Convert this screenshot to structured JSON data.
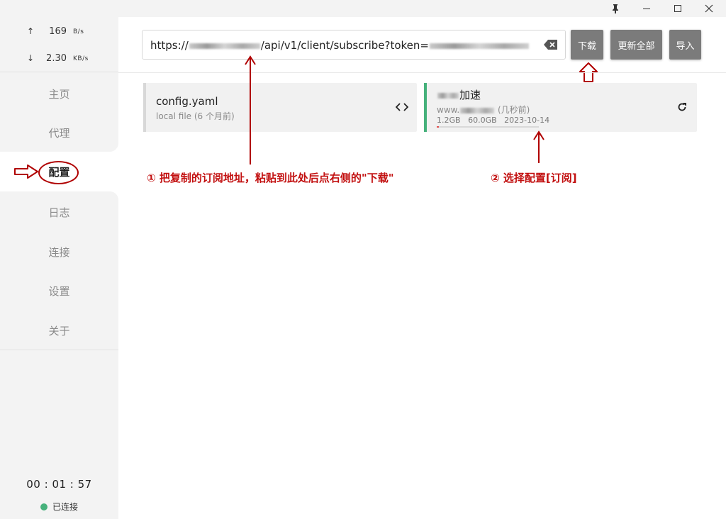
{
  "window": {
    "pin_icon": "pin-icon",
    "minimize_icon": "minimize-icon",
    "maximize_icon": "maximize-icon",
    "close_icon": "close-icon"
  },
  "traffic": {
    "upload": {
      "arrow": "↑",
      "value": "169",
      "unit": "B/s"
    },
    "download": {
      "arrow": "↓",
      "value": "2.30",
      "unit": "KB/s"
    }
  },
  "nav": {
    "items": [
      "主页",
      "代理",
      "配置",
      "日志",
      "连接",
      "设置",
      "关于"
    ],
    "active": "配置"
  },
  "footer": {
    "timer": "00 : 01 : 57",
    "status": "已连接",
    "status_color": "#46b17b"
  },
  "url_bar": {
    "prefix": "https://",
    "middle": "/api/v1/client/subscribe?token=",
    "clear_icon": "backspace-icon"
  },
  "buttons": {
    "download": "下载",
    "update_all": "更新全部",
    "import": "导入"
  },
  "profiles": [
    {
      "title": "config.yaml",
      "subtitle": "local file (6 个月前)",
      "action_icon": "code-brackets-icon"
    },
    {
      "title_suffix": "加速",
      "subtitle_prefix": "www.",
      "subtitle_suffix": "(几秒前)",
      "used": "1.2GB",
      "total": "60.0GB",
      "expire": "2023-10-14",
      "usage_fraction": 0.02,
      "selected_color": "#46b17b",
      "action_icon": "refresh-icon"
    }
  ],
  "annotations": {
    "step1": "① 把复制的订阅地址，粘贴到此处后点右侧的\"下载\"",
    "step2": "② 选择配置[订阅]",
    "color": "#c21010"
  }
}
